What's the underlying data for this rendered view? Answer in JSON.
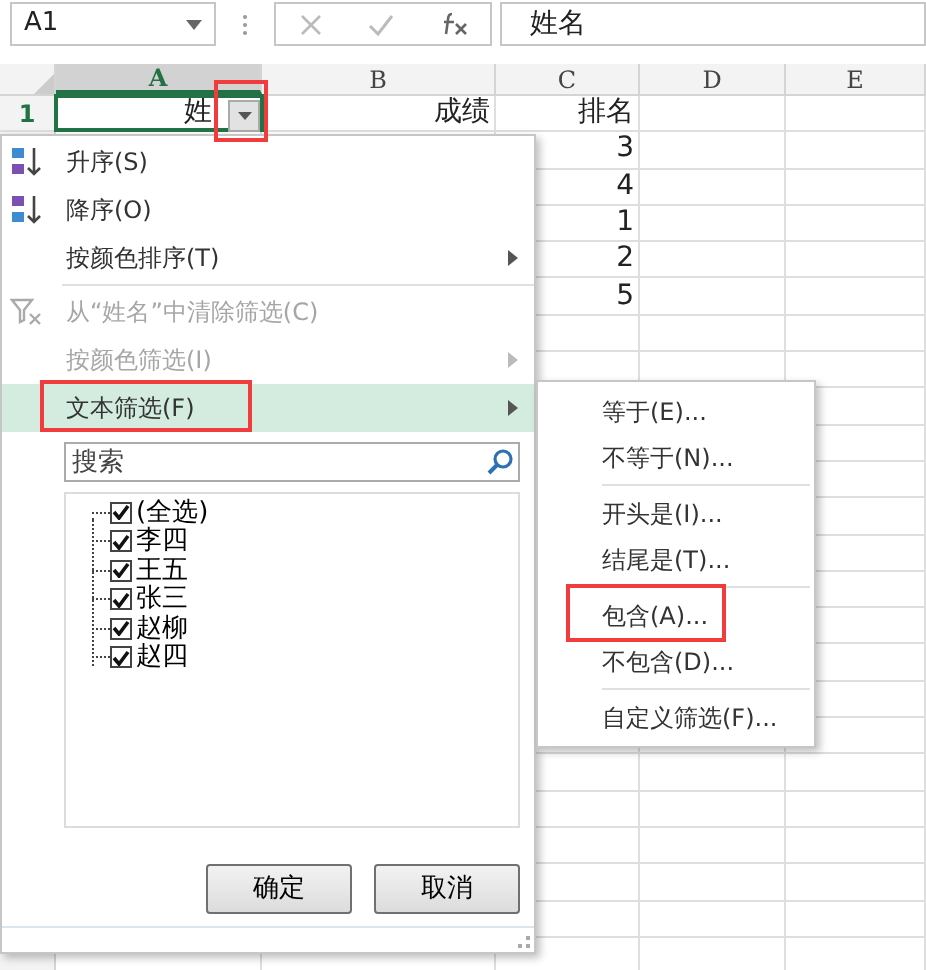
{
  "formula_bar": {
    "name_box": "A1",
    "formula": "姓名"
  },
  "columns": [
    {
      "label": "A",
      "selected": true
    },
    {
      "label": "B",
      "selected": false
    },
    {
      "label": "C",
      "selected": false
    },
    {
      "label": "D",
      "selected": false
    },
    {
      "label": "E",
      "selected": false
    }
  ],
  "rows": [
    {
      "number": "1",
      "selected": true,
      "cells": [
        "姓",
        "成绩",
        "排名"
      ]
    },
    {
      "cells": [
        "",
        "",
        "3"
      ]
    },
    {
      "cells": [
        "",
        "",
        "4"
      ]
    },
    {
      "cells": [
        "",
        "",
        "1"
      ]
    },
    {
      "cells": [
        "",
        "",
        "2"
      ]
    },
    {
      "cells": [
        "",
        "",
        "5"
      ]
    }
  ],
  "filter_menu": {
    "items": [
      {
        "kind": "sort_asc",
        "label": "升序(S)",
        "disabled": false,
        "submenu": false,
        "selected": false
      },
      {
        "kind": "sort_desc",
        "label": "降序(O)",
        "disabled": false,
        "submenu": false,
        "selected": false
      },
      {
        "kind": "plain",
        "label": "按颜色排序(T)",
        "disabled": false,
        "submenu": true,
        "selected": false
      },
      {
        "kind": "separator"
      },
      {
        "kind": "clear",
        "label": "从“姓名”中清除筛选(C)",
        "disabled": true,
        "submenu": false,
        "selected": false
      },
      {
        "kind": "plain",
        "label": "按颜色筛选(I)",
        "disabled": true,
        "submenu": true,
        "selected": false
      },
      {
        "kind": "plain",
        "label": "文本筛选(F)",
        "disabled": false,
        "submenu": true,
        "selected": true
      }
    ],
    "search": {
      "placeholder": "搜索"
    },
    "values": [
      {
        "label": "(全选)",
        "checked": true
      },
      {
        "label": "李四",
        "checked": true
      },
      {
        "label": "王五",
        "checked": true
      },
      {
        "label": "张三",
        "checked": true
      },
      {
        "label": "赵柳",
        "checked": true
      },
      {
        "label": "赵四",
        "checked": true
      }
    ],
    "buttons": [
      "确定",
      "取消"
    ]
  },
  "text_filter_menu": [
    {
      "kind": "item",
      "label": "等于(E)..."
    },
    {
      "kind": "item",
      "label": "不等于(N)..."
    },
    {
      "kind": "separator"
    },
    {
      "kind": "item",
      "label": "开头是(I)..."
    },
    {
      "kind": "item",
      "label": "结尾是(T)..."
    },
    {
      "kind": "separator"
    },
    {
      "kind": "item",
      "label": "包含(A)..."
    },
    {
      "kind": "item",
      "label": "不包含(D)..."
    },
    {
      "kind": "separator"
    },
    {
      "kind": "item",
      "label": "自定义筛选(F)..."
    }
  ]
}
